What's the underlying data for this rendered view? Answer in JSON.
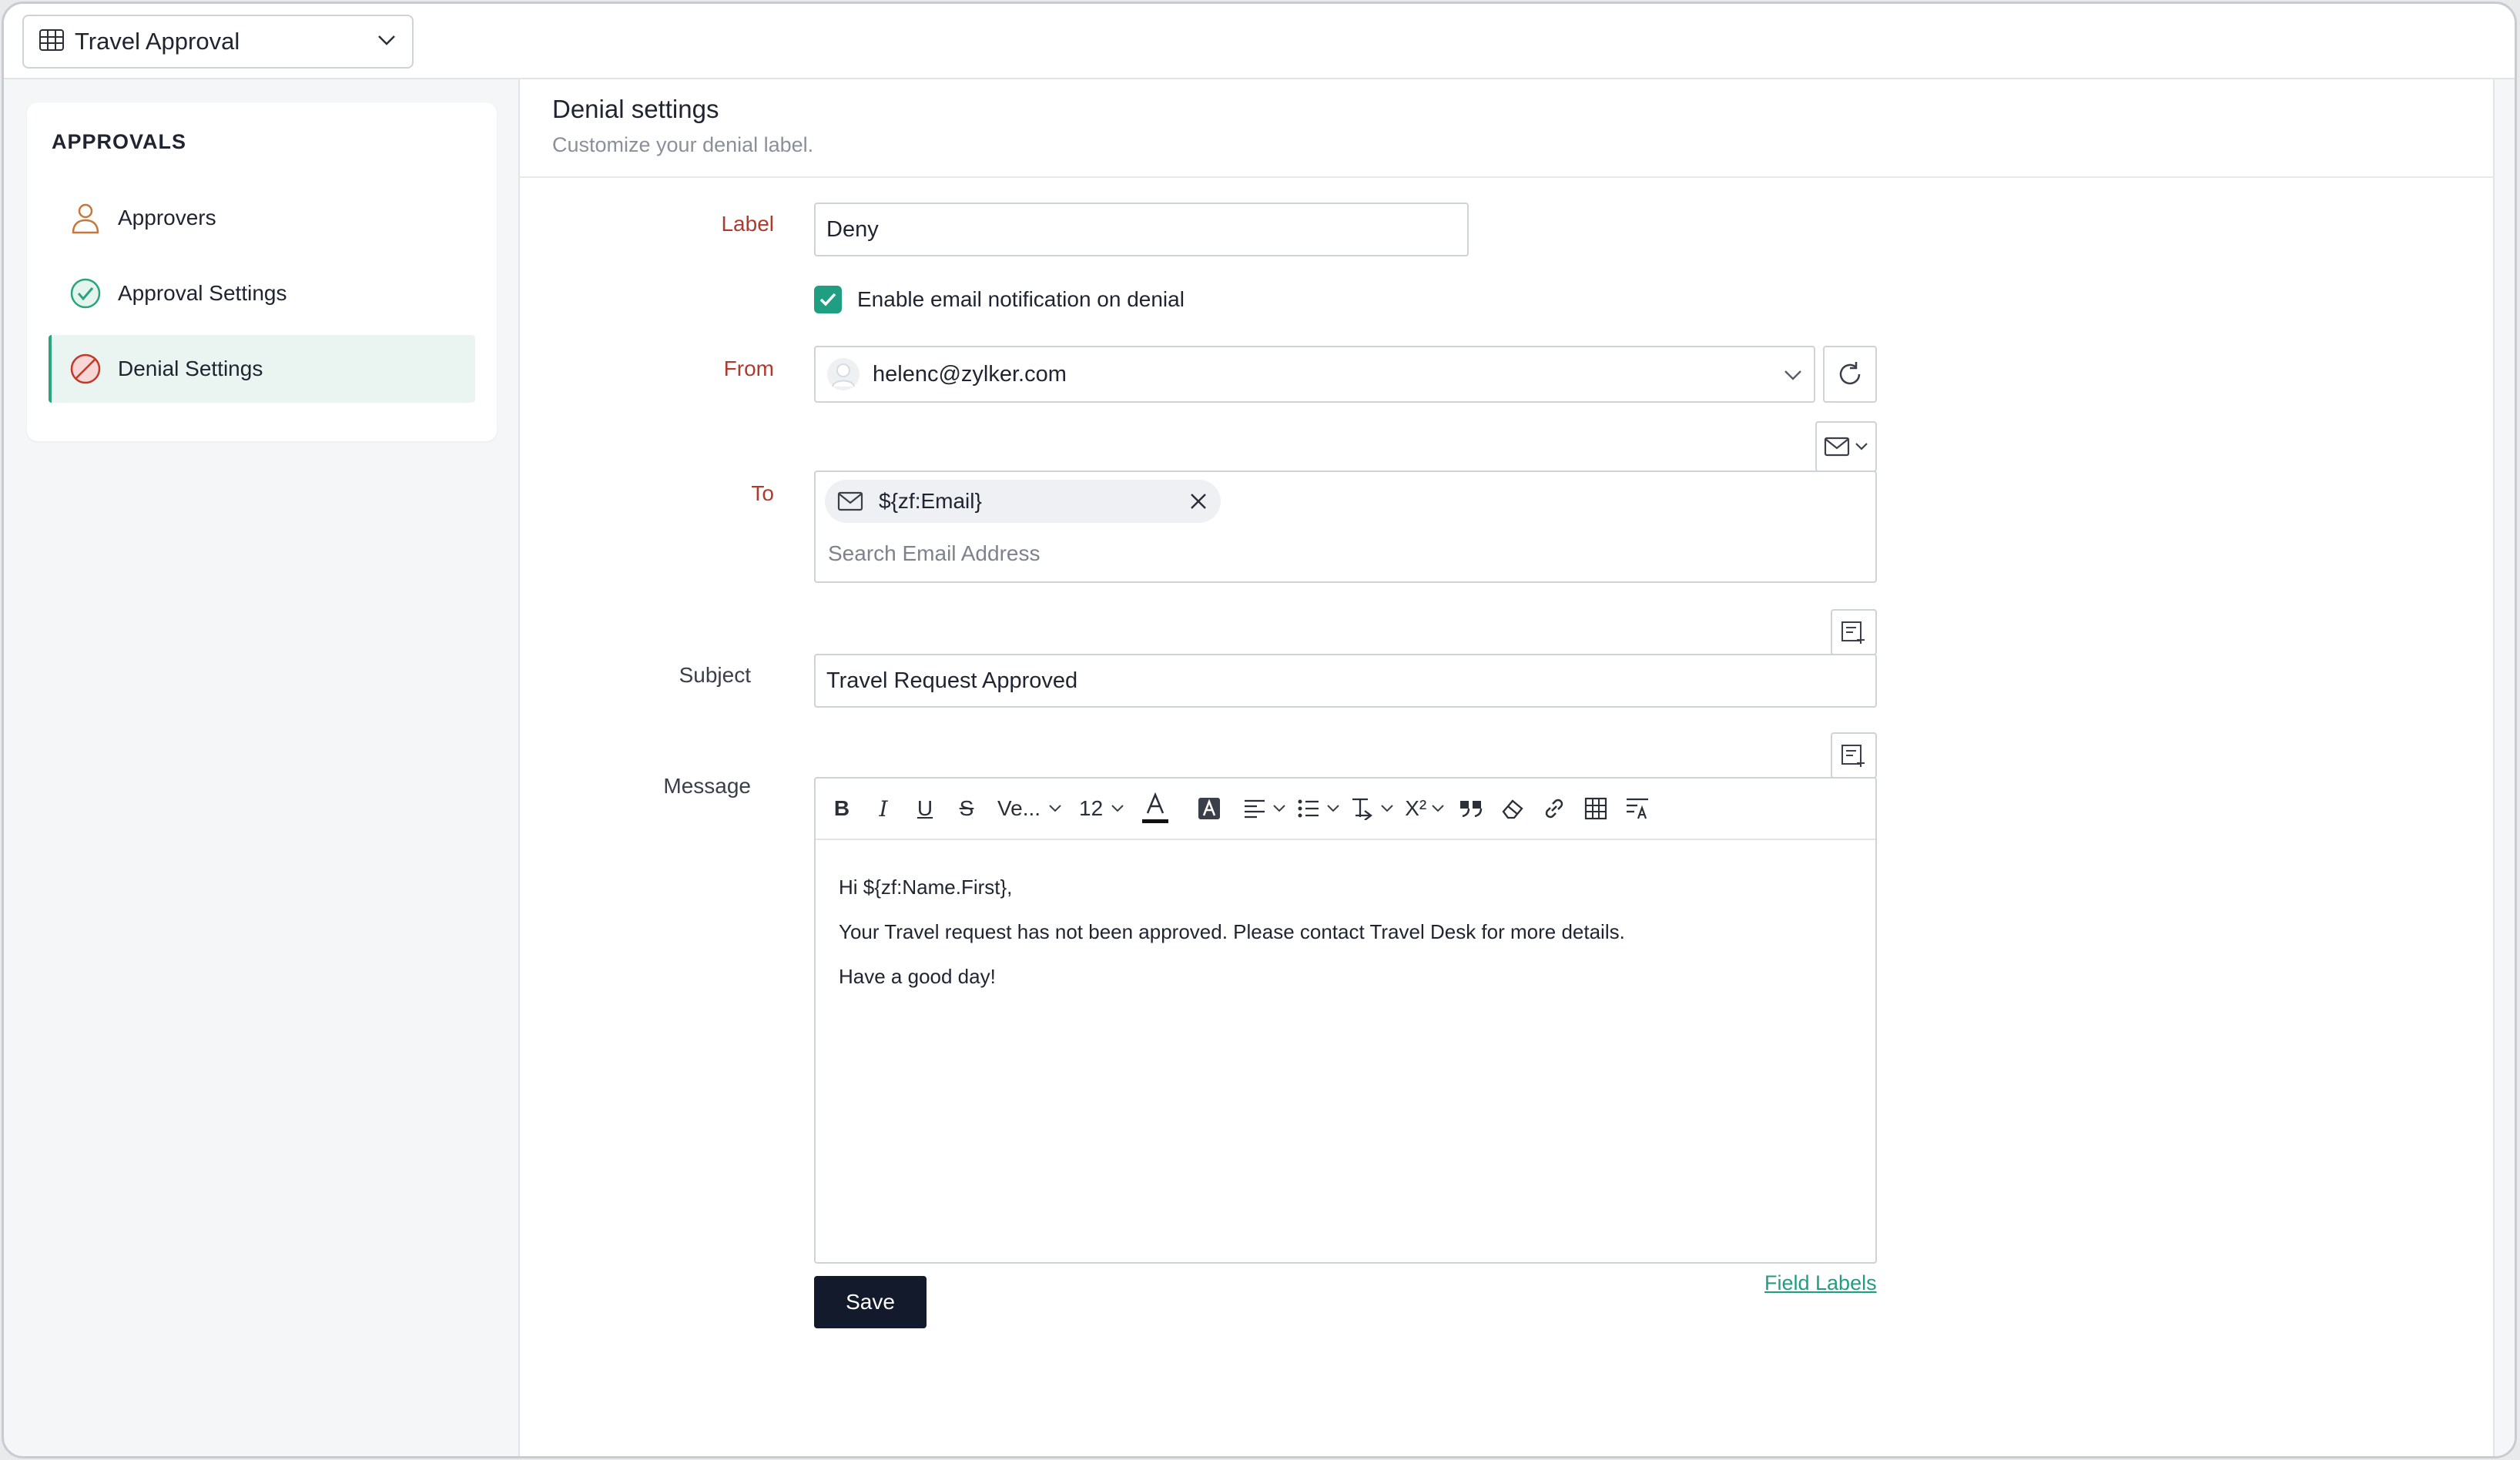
{
  "app_selector": {
    "label": "Travel Approval"
  },
  "sidebar": {
    "heading": "APPROVALS",
    "items": [
      {
        "label": "Approvers",
        "icon": "user-icon"
      },
      {
        "label": "Approval Settings",
        "icon": "check-circle-icon"
      },
      {
        "label": "Denial Settings",
        "icon": "deny-circle-icon",
        "active": true
      }
    ]
  },
  "header": {
    "title": "Denial settings",
    "subtitle": "Customize your denial label."
  },
  "form": {
    "label": {
      "caption": "Label",
      "value": "Deny"
    },
    "notify": {
      "text": "Enable email notification on denial",
      "checked": true
    },
    "from": {
      "caption": "From",
      "value": "helenc@zylker.com"
    },
    "to": {
      "caption": "To",
      "chip": "${zf:Email}",
      "placeholder": "Search Email Address"
    },
    "subject": {
      "caption": "Subject",
      "value": "Travel Request Approved"
    },
    "message": {
      "caption": "Message",
      "font_family": "Ve...",
      "font_size": "12",
      "lines": [
        "Hi ${zf:Name.First},",
        "Your Travel request has not been approved. Please contact Travel Desk for more details.",
        "Have a good day!"
      ]
    },
    "field_labels_link": "Field Labels",
    "save_label": "Save"
  },
  "colors": {
    "accent": "#1f9e82",
    "required_label": "#b03a2e",
    "save_button": "#121a2b"
  }
}
